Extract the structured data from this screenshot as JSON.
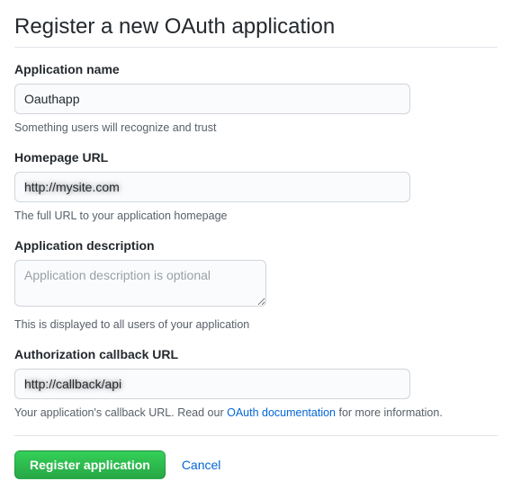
{
  "page": {
    "title": "Register a new OAuth application"
  },
  "fields": {
    "appName": {
      "label": "Application name",
      "value": "Oauthapp",
      "hint": "Something users will recognize and trust"
    },
    "homepage": {
      "label": "Homepage URL",
      "value": "http://mysite.com",
      "hint": "The full URL to your application homepage"
    },
    "description": {
      "label": "Application description",
      "placeholder": "Application description is optional",
      "hint": "This is displayed to all users of your application"
    },
    "callback": {
      "label": "Authorization callback URL",
      "value": "http://callback/api",
      "hintPrefix": "Your application's callback URL. Read our ",
      "hintLink": "OAuth documentation",
      "hintSuffix": " for more information."
    }
  },
  "actions": {
    "submit": "Register application",
    "cancel": "Cancel"
  }
}
